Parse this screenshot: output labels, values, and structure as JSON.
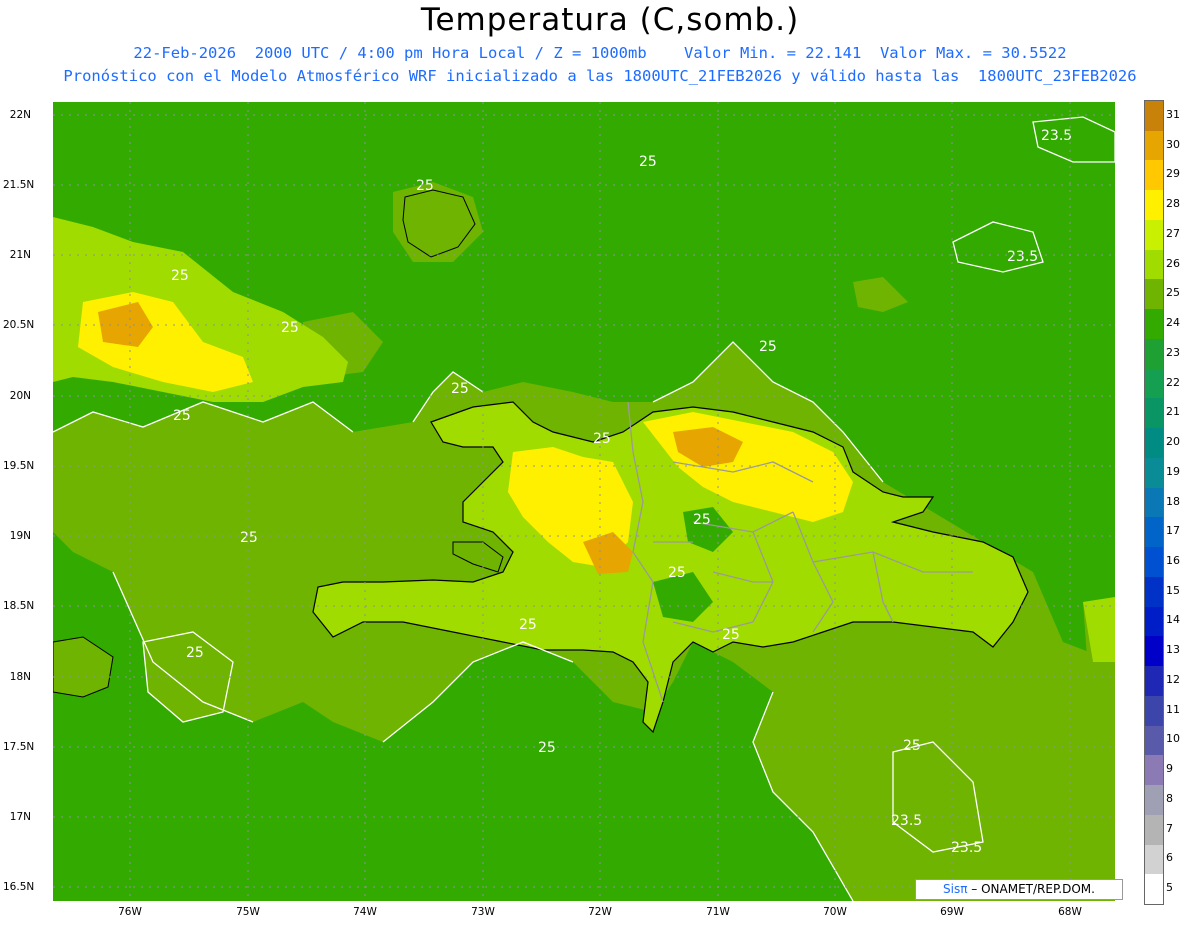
{
  "header": {
    "title": "Temperatura (C,somb.)",
    "line1": "22-Feb-2026  2000 UTC / 4:00 pm Hora Local / Z = 1000mb    Valor Min. = 22.141  Valor Max. = 30.5522",
    "line2": "Pronóstico con el Modelo Atmosférico WRF inicializado a las 1800UTC_21FEB2026 y válido hasta las  1800UTC_23FEB2026"
  },
  "axes": {
    "lat_labels": [
      "22N",
      "21.5N",
      "21N",
      "20.5N",
      "20N",
      "19.5N",
      "19N",
      "18.5N",
      "18N",
      "17.5N",
      "17N",
      "16.5N"
    ],
    "lon_labels": [
      "76W",
      "75W",
      "74W",
      "73W",
      "72W",
      "71W",
      "70W",
      "69W",
      "68W"
    ]
  },
  "contour_labels": [
    "25",
    "25",
    "25",
    "25",
    "25",
    "25",
    "25",
    "25",
    "25",
    "25",
    "25",
    "25",
    "25",
    "25",
    "25",
    "25",
    "23.5",
    "23.5",
    "23.5",
    "23.5"
  ],
  "colorbar": {
    "labels": [
      "31",
      "30",
      "29",
      "28",
      "27",
      "26",
      "25",
      "24",
      "23",
      "22",
      "21",
      "20",
      "19",
      "18",
      "17",
      "16",
      "15",
      "14",
      "13",
      "12",
      "11",
      "10",
      "9",
      "8",
      "7",
      "6",
      "5"
    ],
    "colors": [
      "#c8820a",
      "#e6a500",
      "#ffc800",
      "#fff000",
      "#c8f000",
      "#a0dc00",
      "#6eb400",
      "#32aa00",
      "#1ea032",
      "#14a050",
      "#0a9664",
      "#008c82",
      "#0a8c96",
      "#0a78b4",
      "#0064c8",
      "#0050d2",
      "#0032c8",
      "#001ec8",
      "#0000c8",
      "#1e28b4",
      "#3c46aa",
      "#5a5aaa",
      "#8c7ab4",
      "#a0a0b4",
      "#b4b4b4",
      "#d2d2d2",
      "#ffffff"
    ]
  },
  "credit": {
    "brand": "Sisπ",
    "text": " – ONAMET/REP.DOM."
  }
}
